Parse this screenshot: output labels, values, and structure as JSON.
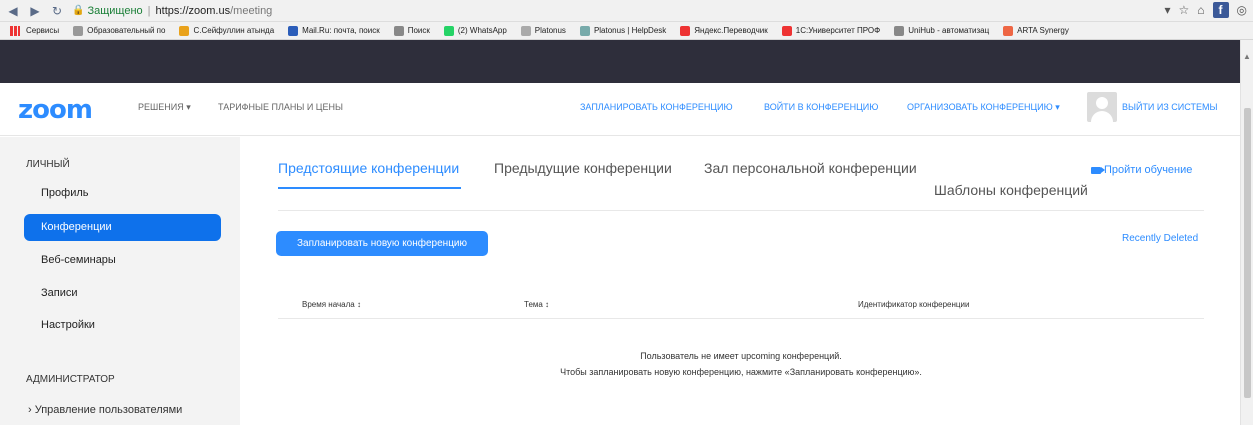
{
  "browser": {
    "secure_label": "Защищено",
    "url_host": "https://zoom.us",
    "url_path": "/meeting",
    "bookmarks": [
      {
        "label": "Сервисы",
        "color": "#c33"
      },
      {
        "label": "Образовательный по",
        "color": "#999"
      },
      {
        "label": "С.Сейфуллин атында",
        "color": "#e9a21b"
      },
      {
        "label": "Mail.Ru: почта, поиск",
        "color": "#2b5db9"
      },
      {
        "label": "Поиск",
        "color": "#888"
      },
      {
        "label": "(2) WhatsApp",
        "color": "#25d366"
      },
      {
        "label": "Platonus",
        "color": "#aaa"
      },
      {
        "label": "Platonus | HelpDesk",
        "color": "#7aa"
      },
      {
        "label": "Яндекс.Переводчик",
        "color": "#e33"
      },
      {
        "label": "1С:Университет ПРОФ",
        "color": "#e33"
      },
      {
        "label": "UniHub - автоматизац",
        "color": "#888"
      },
      {
        "label": "ARTA Synergy",
        "color": "#e64"
      }
    ]
  },
  "header": {
    "logo": "zoom",
    "nav_solutions": "РЕШЕНИЯ ▾",
    "nav_plans": "ТАРИФНЫЕ ПЛАНЫ И ЦЕНЫ",
    "nav_schedule": "ЗАПЛАНИРОВАТЬ КОНФЕРЕНЦИЮ",
    "nav_join": "ВОЙТИ В КОНФЕРЕНЦИЮ",
    "nav_host": "ОРГАНИЗОВАТЬ КОНФЕРЕНЦИЮ ▾",
    "nav_signout": "ВЫЙТИ ИЗ СИСТЕМЫ"
  },
  "sidebar": {
    "personal_title": "ЛИЧНЫЙ",
    "items": [
      {
        "label": "Профиль"
      },
      {
        "label": "Конференции",
        "active": true
      },
      {
        "label": "Веб-семинары"
      },
      {
        "label": "Записи"
      },
      {
        "label": "Настройки"
      }
    ],
    "admin_title": "АДМИНИСТРАТОР",
    "admin_item": "› Управление пользователями"
  },
  "main": {
    "tabs": [
      {
        "label": "Предстоящие конференции",
        "active": true
      },
      {
        "label": "Предыдущие конференции"
      },
      {
        "label": "Зал персональной конференции"
      },
      {
        "label": "Шаблоны конференций"
      }
    ],
    "training_link": "Пройти обучение",
    "schedule_button": "Запланировать новую конференцию",
    "recently_deleted": "Recently Deleted",
    "columns": [
      "Время начала ↕",
      "Тема ↕",
      "Идентификатор конференции"
    ],
    "empty_line1": "Пользователь не имеет upcoming конференций.",
    "empty_line2": "Чтобы запланировать новую конференцию, нажмите «Запланировать конференцию»."
  }
}
